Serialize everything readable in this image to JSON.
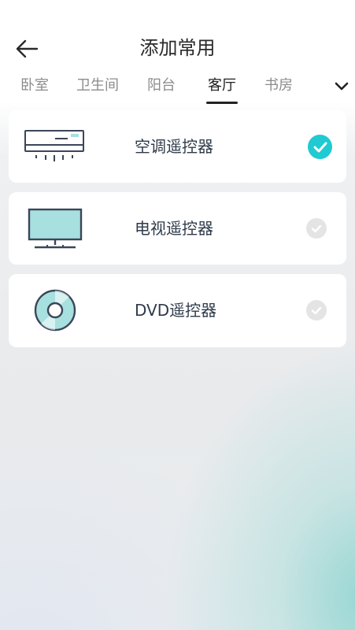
{
  "header": {
    "title": "添加常用",
    "back_icon": "arrow-left-icon"
  },
  "tabs": [
    {
      "label": "卧室",
      "active": false
    },
    {
      "label": "卫生间",
      "active": false
    },
    {
      "label": "阳台",
      "active": false
    },
    {
      "label": "客厅",
      "active": true
    },
    {
      "label": "书房",
      "active": false
    }
  ],
  "tab_more_icon": "chevron-down-icon",
  "devices": [
    {
      "label": "空调遥控器",
      "icon": "air-conditioner-icon",
      "selected": true
    },
    {
      "label": "电视遥控器",
      "icon": "tv-icon",
      "selected": false
    },
    {
      "label": "DVD遥控器",
      "icon": "dvd-disc-icon",
      "selected": false
    }
  ],
  "colors": {
    "accent": "#1fcad2",
    "icon_fill": "#a8dfdf",
    "icon_stroke": "#3a4658",
    "check_off": "#e4e4e4"
  }
}
